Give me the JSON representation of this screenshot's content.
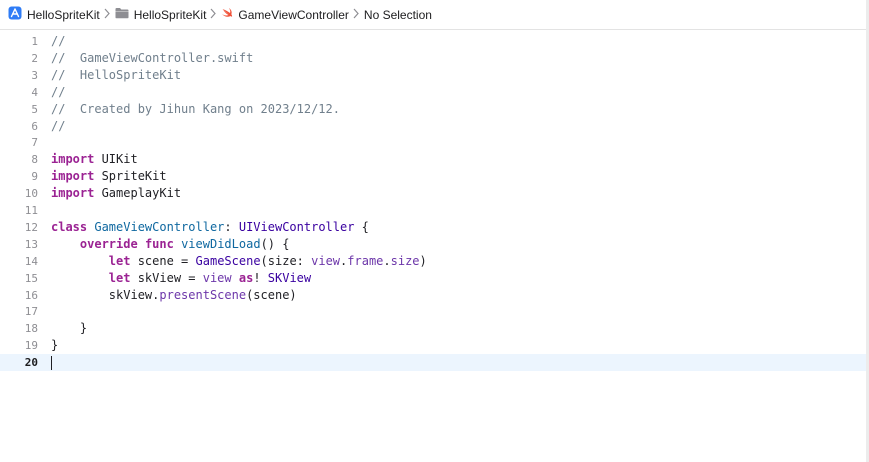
{
  "jumpbar": {
    "project": "HelloSpriteKit",
    "folder": "HelloSpriteKit",
    "file": "GameViewController",
    "symbol": "No Selection",
    "icons": [
      "app-project-icon",
      "folder-icon",
      "swift-file-icon",
      "chevron-right-icon"
    ],
    "colors": {
      "project_icon": "#2f7cf6",
      "folder_icon": "#8e8e93",
      "swift_icon": "#f05138"
    }
  },
  "editor": {
    "current_line": 20,
    "colors": {
      "comment": "#707f8c",
      "keyword": "#9b2393",
      "type": "#3900a0",
      "declaration": "#0f68a0",
      "property": "#6c36a9",
      "current_line_bg": "#ecf5fe"
    },
    "lines": [
      {
        "n": "1",
        "tokens": [
          [
            "c",
            "//"
          ]
        ]
      },
      {
        "n": "2",
        "tokens": [
          [
            "c",
            "//  GameViewController.swift"
          ]
        ]
      },
      {
        "n": "3",
        "tokens": [
          [
            "c",
            "//  HelloSpriteKit"
          ]
        ]
      },
      {
        "n": "4",
        "tokens": [
          [
            "c",
            "//"
          ]
        ]
      },
      {
        "n": "5",
        "tokens": [
          [
            "c",
            "//  Created by Jihun Kang on 2023/12/12."
          ]
        ]
      },
      {
        "n": "6",
        "tokens": [
          [
            "c",
            "//"
          ]
        ]
      },
      {
        "n": "7",
        "tokens": []
      },
      {
        "n": "8",
        "tokens": [
          [
            "k",
            "import"
          ],
          [
            "p",
            " UIKit"
          ]
        ]
      },
      {
        "n": "9",
        "tokens": [
          [
            "k",
            "import"
          ],
          [
            "p",
            " SpriteKit"
          ]
        ]
      },
      {
        "n": "10",
        "tokens": [
          [
            "k",
            "import"
          ],
          [
            "p",
            " GameplayKit"
          ]
        ]
      },
      {
        "n": "11",
        "tokens": []
      },
      {
        "n": "12",
        "tokens": [
          [
            "k",
            "class"
          ],
          [
            "p",
            " "
          ],
          [
            "d",
            "GameViewController"
          ],
          [
            "p",
            ": "
          ],
          [
            "t",
            "UIViewController"
          ],
          [
            "p",
            " {"
          ]
        ]
      },
      {
        "n": "13",
        "tokens": [
          [
            "p",
            "    "
          ],
          [
            "k",
            "override"
          ],
          [
            "p",
            " "
          ],
          [
            "k",
            "func"
          ],
          [
            "p",
            " "
          ],
          [
            "d",
            "viewDidLoad"
          ],
          [
            "p",
            "() {"
          ]
        ]
      },
      {
        "n": "14",
        "tokens": [
          [
            "p",
            "        "
          ],
          [
            "k",
            "let"
          ],
          [
            "p",
            " scene = "
          ],
          [
            "t",
            "GameScene"
          ],
          [
            "p",
            "(size: "
          ],
          [
            "r",
            "view"
          ],
          [
            "p",
            "."
          ],
          [
            "r",
            "frame"
          ],
          [
            "p",
            "."
          ],
          [
            "r",
            "size"
          ],
          [
            "p",
            ")"
          ]
        ]
      },
      {
        "n": "15",
        "tokens": [
          [
            "p",
            "        "
          ],
          [
            "k",
            "let"
          ],
          [
            "p",
            " skView = "
          ],
          [
            "r",
            "view"
          ],
          [
            "p",
            " "
          ],
          [
            "k",
            "as"
          ],
          [
            "p",
            "! "
          ],
          [
            "t",
            "SKView"
          ]
        ]
      },
      {
        "n": "16",
        "tokens": [
          [
            "p",
            "        skView."
          ],
          [
            "r",
            "presentScene"
          ],
          [
            "p",
            "(scene)"
          ]
        ]
      },
      {
        "n": "17",
        "tokens": []
      },
      {
        "n": "18",
        "tokens": [
          [
            "p",
            "    }"
          ]
        ]
      },
      {
        "n": "19",
        "tokens": [
          [
            "p",
            "}"
          ]
        ]
      },
      {
        "n": "20",
        "tokens": []
      }
    ]
  }
}
